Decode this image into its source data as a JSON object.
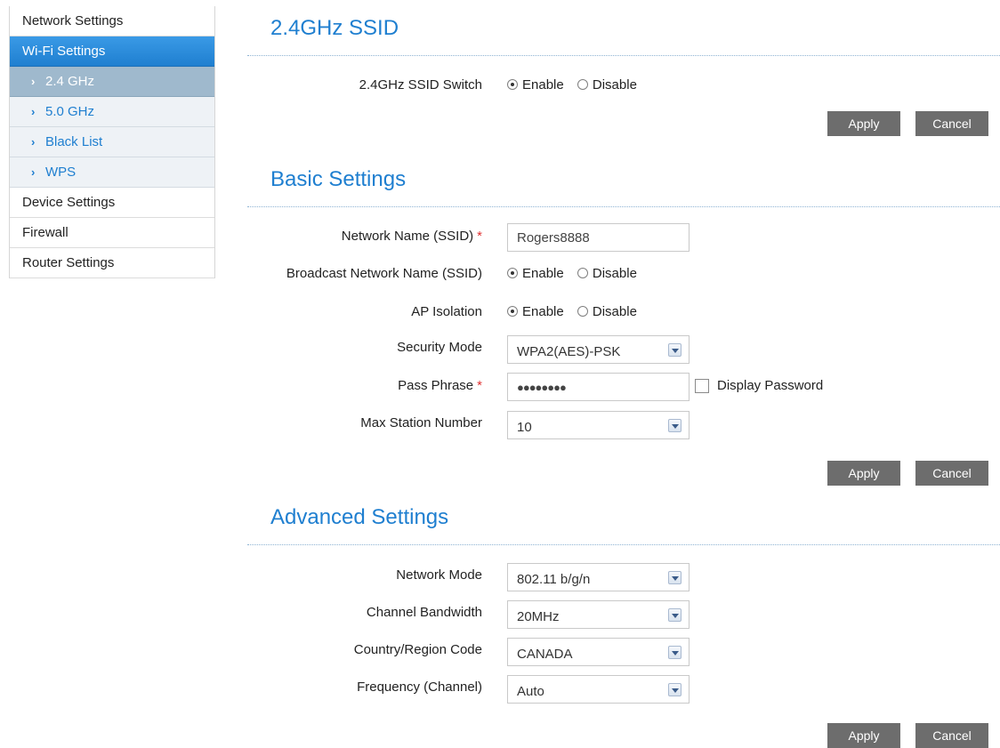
{
  "sidebar": {
    "items": [
      {
        "label": "Network Settings"
      },
      {
        "label": "Wi-Fi Settings"
      },
      {
        "label": "2.4 GHz"
      },
      {
        "label": "5.0 GHz"
      },
      {
        "label": "Black List"
      },
      {
        "label": "WPS"
      },
      {
        "label": "Device Settings"
      },
      {
        "label": "Firewall"
      },
      {
        "label": "Router Settings"
      }
    ],
    "chevron": "›"
  },
  "ssid_section": {
    "title": "2.4GHz SSID",
    "switch_label": "2.4GHz SSID Switch",
    "enable": "Enable",
    "disable": "Disable",
    "selected": "Enable",
    "apply": "Apply",
    "cancel": "Cancel"
  },
  "basic": {
    "title": "Basic Settings",
    "ssid_label": "Network Name (SSID)",
    "ssid_value": "Rogers8888",
    "required_mark": "*",
    "broadcast_label": "Broadcast Network Name (SSID)",
    "broadcast_enable": "Enable",
    "broadcast_disable": "Disable",
    "isolation_label": "AP Isolation",
    "isolation_enable": "Enable",
    "isolation_disable": "Disable",
    "security_label": "Security Mode",
    "security_value": "WPA2(AES)-PSK",
    "pass_label": "Pass Phrase",
    "pass_value": "●●●●●●●●",
    "display_password": "Display Password",
    "max_station_label": "Max Station Number",
    "max_station_value": "10",
    "apply": "Apply",
    "cancel": "Cancel"
  },
  "advanced": {
    "title": "Advanced Settings",
    "mode_label": "Network Mode",
    "mode_value": "802.11 b/g/n",
    "bandwidth_label": "Channel Bandwidth",
    "bandwidth_value": "20MHz",
    "country_label": "Country/Region Code",
    "country_value": "CANADA",
    "frequency_label": "Frequency (Channel)",
    "frequency_value": "Auto",
    "apply": "Apply",
    "cancel": "Cancel"
  }
}
